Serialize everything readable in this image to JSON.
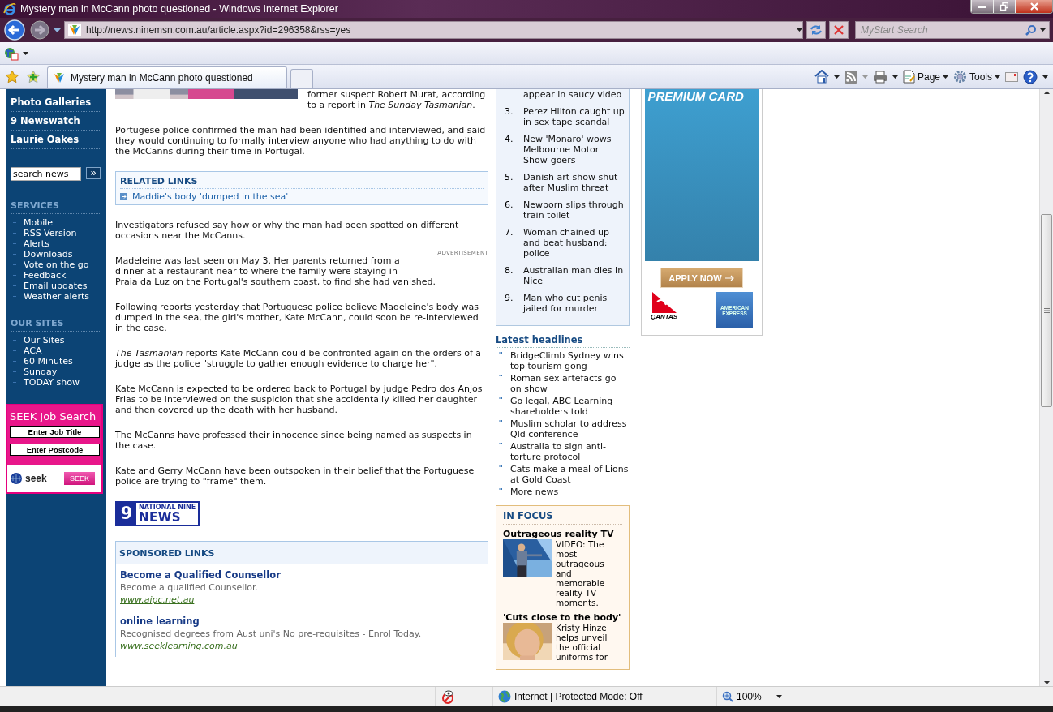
{
  "window": {
    "title": "Mystery man in McCann photo questioned - Windows Internet Explorer"
  },
  "address_bar": {
    "url": "http://news.ninemsn.com.au/article.aspx?id=296358&rss=yes"
  },
  "search_field": {
    "placeholder": "MyStart Search"
  },
  "tabs": [
    {
      "label": "Mystery man in McCann photo questioned",
      "selected": true
    }
  ],
  "command_bar": {
    "page_menu": "Page",
    "tools_menu": "Tools"
  },
  "left_nav": {
    "links": [
      "Photo Galleries",
      "9 Newswatch",
      "Laurie Oakes"
    ],
    "search": {
      "value": "search news",
      "button": "»"
    },
    "sections": [
      {
        "heading": "SERVICES",
        "items": [
          "Mobile",
          "RSS Version",
          "Alerts",
          "Downloads",
          "Vote on the go",
          "Feedback",
          "Email updates",
          "Weather alerts"
        ]
      },
      {
        "heading": "OUR SITES",
        "items": [
          "Our Sites",
          "ACA",
          "60 Minutes",
          "Sunday",
          "TODAY show"
        ]
      }
    ]
  },
  "seek_widget": {
    "title": "SEEK Job Search",
    "field_placeholders": [
      "Enter Job Title",
      "Enter Postcode"
    ],
    "logo": "seek",
    "button": "SEEK"
  },
  "article": {
    "intro": "former suspect Robert Murat, according to a report in *The Sunday Tasmanian*.",
    "blocks": [
      {
        "kind": "paragraph",
        "text": "Portugese police confirmed the man had been identified and interviewed, and said they would continuing to formally interview anyone who had anything to do with the McCanns during their time in Portugal."
      },
      {
        "kind": "related",
        "heading": "RELATED LINKS",
        "links": [
          "Maddie's body 'dumped in the sea'"
        ]
      },
      {
        "kind": "paragraph",
        "text": "Investigators refused say how or why the man had been spotted on different occasions near the McCanns."
      },
      {
        "kind": "advert",
        "label": "ADVERTISEMENT",
        "text": "Madeleine was last seen on May 3. Her parents returned from a dinner at a restaurant near to where the family were staying in Praia da Luz on the Portugal's southern coast, to find she had vanished."
      },
      {
        "kind": "paragraph",
        "text": "Following reports yesterday that Portuguese police believe Madeleine's body was dumped in the sea, the girl's mother, Kate McCann, could soon be re-interviewed in the case."
      },
      {
        "kind": "paragraph",
        "text": "*The Tasmanian* reports Kate McCann could be confronted again on the orders of a judge as the police \"struggle to gather enough evidence to charge her\"."
      },
      {
        "kind": "paragraph",
        "text": "Kate McCann is expected to be ordered back to Portugal by judge Pedro dos Anjos Frias to be interviewed on the suspicion that she accidentally killed her daughter and then covered up the death with her husband."
      },
      {
        "kind": "paragraph",
        "text": "The McCanns have professed their innocence since being named as suspects in the case."
      },
      {
        "kind": "paragraph",
        "text": "Kate and Gerry McCann have been outspoken in their belief that the Portuguese police are trying to \"frame\" them."
      }
    ],
    "logo": {
      "numeral": "9",
      "top": "NATIONAL NINE",
      "word": "NEWS"
    },
    "sponsored": {
      "heading": "SPONSORED LINKS",
      "items": [
        {
          "title": "Become a Qualified Counsellor",
          "description": "Become a qualified Counsellor.",
          "url": "www.aipc.net.au"
        },
        {
          "title": "online learning",
          "description": "Recognised degrees from Aust uni's No pre-requisites - Enrol Today.",
          "url": "www.seeklearning.com.au"
        }
      ]
    }
  },
  "popular": {
    "items": [
      {
        "text": "appear in saucy video"
      },
      {
        "number": "3.",
        "text": "Perez Hilton caught up in sex tape scandal"
      },
      {
        "number": "4.",
        "text": "New 'Monaro' wows Melbourne Motor Show-goers"
      },
      {
        "number": "5.",
        "text": "Danish art show shut after Muslim threat"
      },
      {
        "number": "6.",
        "text": "Newborn slips through train toilet"
      },
      {
        "number": "7.",
        "text": "Woman chained up and beat husband: police"
      },
      {
        "number": "8.",
        "text": "Australian man dies in Nice"
      },
      {
        "number": "9.",
        "text": "Man who cut penis jailed for murder"
      }
    ]
  },
  "latest_headlines": {
    "heading": "Latest headlines",
    "items": [
      "BridgeClimb Sydney wins top tourism gong",
      "Roman sex artefacts go on show",
      "Go legal, ABC Learning shareholders told",
      "Muslim scholar to address Qld conference",
      "Australia to sign anti-torture protocol",
      "Cats make a meal of Lions at Gold Coast",
      "More news"
    ]
  },
  "in_focus": {
    "heading": "IN FOCUS",
    "stories": [
      {
        "title": "Outrageous reality TV",
        "text": "VIDEO: The most outrageous and memorable reality TV moments."
      },
      {
        "title": "'Cuts close to the body'",
        "text": "Kristy Hinze helps unveil the official uniforms for"
      }
    ]
  },
  "advert": {
    "heading": "PREMIUM CARD",
    "button": "APPLY NOW",
    "airline": "QANTAS",
    "card": "AMERICAN EXPRESS"
  },
  "status_bar": {
    "zone": "Internet | Protected Mode: Off",
    "zoom": "100%"
  }
}
